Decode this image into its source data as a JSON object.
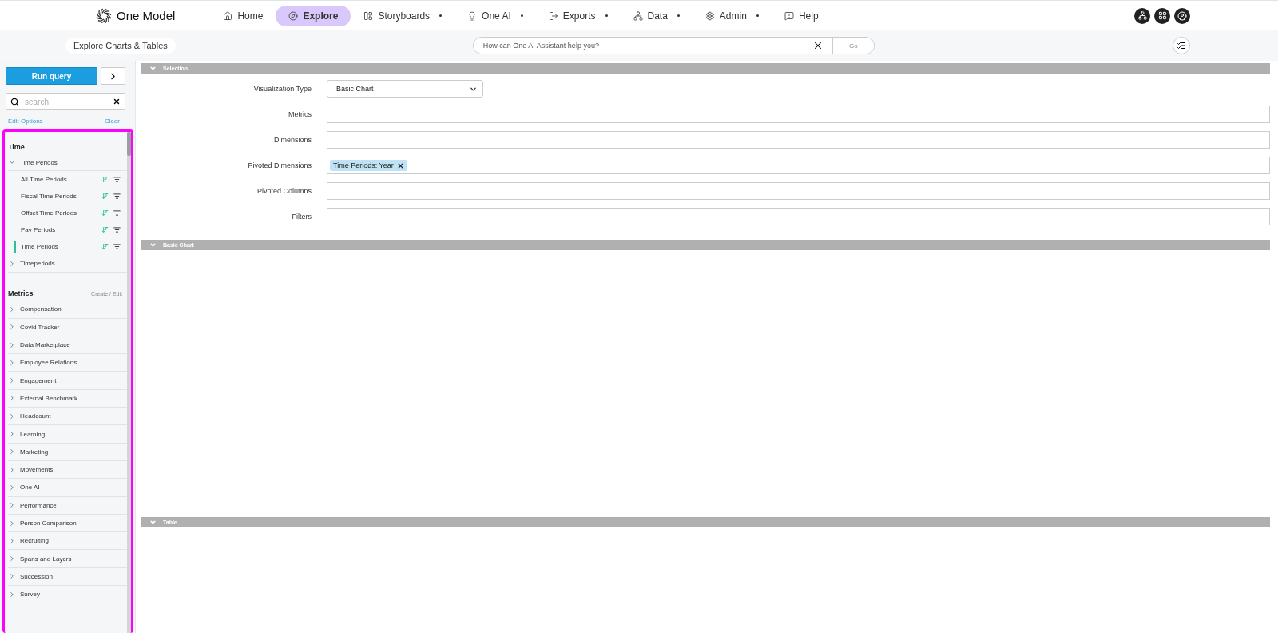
{
  "nav": {
    "brand": "One Model",
    "items": [
      {
        "label": "Home",
        "selected": false,
        "has_menu": false
      },
      {
        "label": "Explore",
        "selected": true,
        "has_menu": false
      },
      {
        "label": "Storyboards",
        "selected": false,
        "has_menu": true
      },
      {
        "label": "One AI",
        "selected": false,
        "has_menu": true
      },
      {
        "label": "Exports",
        "selected": false,
        "has_menu": true
      },
      {
        "label": "Data",
        "selected": false,
        "has_menu": true
      },
      {
        "label": "Admin",
        "selected": false,
        "has_menu": true
      },
      {
        "label": "Help",
        "selected": false,
        "has_menu": false
      }
    ]
  },
  "subheader": {
    "title": "Explore Charts & Tables",
    "assistant": {
      "placeholder": "How can One AI Assistant help you?",
      "button": "Go"
    }
  },
  "sidebar": {
    "run_button": "Run query",
    "search": {
      "placeholder": "search"
    },
    "edit_options": "Edit Options",
    "clear": "Clear",
    "sections": [
      {
        "title": "Time",
        "items": [
          {
            "label": "Time Periods",
            "expanded": true,
            "children": [
              {
                "label": "All Time Periods",
                "selected": false
              },
              {
                "label": "Fiscal Time Periods",
                "selected": false
              },
              {
                "label": "Offset Time Periods",
                "selected": false
              },
              {
                "label": "Pay Periods",
                "selected": false
              },
              {
                "label": "Time Periods",
                "selected": true
              }
            ]
          },
          {
            "label": "Timeperiods",
            "expanded": false
          }
        ]
      },
      {
        "title": "Metrics",
        "action": "Create / Edit",
        "items": [
          {
            "label": "Compensation",
            "expanded": false
          },
          {
            "label": "Covid Tracker",
            "expanded": false
          },
          {
            "label": "Data Marketplace",
            "expanded": false
          },
          {
            "label": "Employee Relations",
            "expanded": false
          },
          {
            "label": "Engagement",
            "expanded": false
          },
          {
            "label": "External Benchmark",
            "expanded": false
          },
          {
            "label": "Headcount",
            "expanded": false
          },
          {
            "label": "Learning",
            "expanded": false
          },
          {
            "label": "Marketing",
            "expanded": false
          },
          {
            "label": "Movements",
            "expanded": false
          },
          {
            "label": "One AI",
            "expanded": false
          },
          {
            "label": "Performance",
            "expanded": false
          },
          {
            "label": "Person Comparison",
            "expanded": false
          },
          {
            "label": "Recruiting",
            "expanded": false
          },
          {
            "label": "Spans and Layers",
            "expanded": false
          },
          {
            "label": "Succession",
            "expanded": false
          },
          {
            "label": "Survey",
            "expanded": false
          }
        ]
      }
    ]
  },
  "main": {
    "sections": [
      {
        "title": "Selection",
        "kind": "form",
        "expanded": true,
        "fields": [
          {
            "label": "Visualization Type",
            "kind": "select",
            "value": "Basic Chart"
          },
          {
            "label": "Metrics",
            "kind": "tokens"
          },
          {
            "label": "Dimensions",
            "kind": "tokens"
          },
          {
            "label": "Pivoted Dimensions",
            "kind": "tokens",
            "tokens": [
              "Time Periods: Year"
            ]
          },
          {
            "label": "Pivoted Columns",
            "kind": "tokens"
          },
          {
            "label": "Filters",
            "kind": "tokens"
          }
        ]
      },
      {
        "title": "Basic Chart",
        "kind": "chart",
        "expanded": true
      },
      {
        "title": "Table",
        "kind": "table",
        "expanded": true
      }
    ]
  }
}
